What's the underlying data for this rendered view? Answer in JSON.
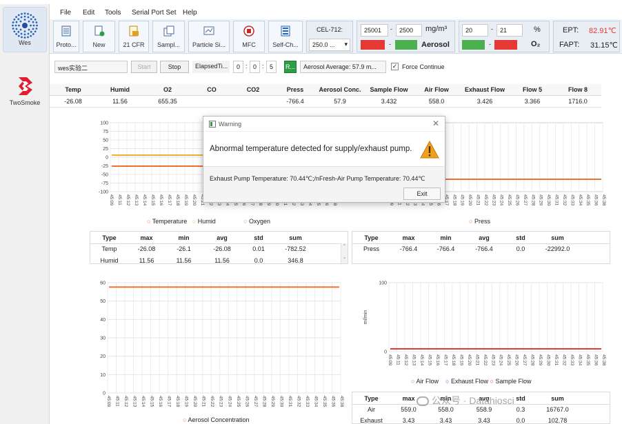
{
  "sidebar": {
    "items": [
      {
        "label": "Wes"
      },
      {
        "label": "TwoSmoke"
      }
    ]
  },
  "menu": {
    "items": [
      "File",
      "Edit",
      "Tools",
      "Serial Port Set",
      "Help"
    ]
  },
  "toolbar": {
    "buttons": [
      {
        "label": "Proto...",
        "icon": "clipboard-icon"
      },
      {
        "label": "New",
        "icon": "new-doc-icon"
      },
      {
        "label": "21 CFR",
        "icon": "cfr-doc-icon"
      },
      {
        "label": "Sampl...",
        "icon": "copy-icon"
      },
      {
        "label": "Particle Si...",
        "icon": "screen-icon"
      },
      {
        "label": "MFC",
        "icon": "record-icon"
      },
      {
        "label": "Self-Ch...",
        "icon": "check-list-icon"
      }
    ],
    "cel": {
      "title": "CEL-712:",
      "select": "250.0 ..."
    },
    "aerosol": {
      "low": "25001",
      "high": "2500",
      "unit": "mg/m³",
      "label": "Aerosol"
    },
    "o2": {
      "low": "20",
      "high": "21",
      "unit": "%",
      "label": "O₂"
    },
    "temps": {
      "ept_label": "EPT:",
      "ept_value": "82.91℃",
      "fapt_label": "FAPT:",
      "fapt_value": "31.15℃"
    }
  },
  "controls": {
    "name": "wes实验二",
    "start": "Start",
    "stop": "Stop",
    "elapsed_label": "ElapsedTi...",
    "h": "0",
    "m": "0",
    "s": "5",
    "r_btn": "R...",
    "avg": "Aerosol Average:  57.9 m...",
    "force": "Force Continue"
  },
  "live": {
    "headers": [
      "Temp",
      "Humid",
      "O2",
      "CO",
      "CO2",
      "Press",
      "Aerosol Conc.",
      "Sample Flow",
      "Air Flow",
      "Exhaust Flow",
      "Flow 5",
      "Flow 8"
    ],
    "values": [
      "-26.08",
      "11.56",
      "655.35",
      "",
      "",
      "-766.4",
      "57.9",
      "3.432",
      "558.0",
      "3.426",
      "3.366",
      "1716.0"
    ]
  },
  "chart1": {
    "yticks": [
      "100",
      "75",
      "50",
      "25",
      "0",
      "-25",
      "-50",
      "-75",
      "-100"
    ],
    "legend": [
      "Temperature",
      "Humid",
      "Oxygen"
    ]
  },
  "chart2": {
    "legend": [
      "Press"
    ]
  },
  "chart3": {
    "yticks": [
      "60",
      "50",
      "40",
      "30",
      "20",
      "10",
      "0"
    ],
    "legend": [
      "Aerosol Concentration"
    ]
  },
  "chart4": {
    "yticks": [
      "100",
      "0"
    ],
    "ylabel": "ml/min",
    "legend": [
      "Air Flow",
      "Exhaust Flow",
      "Sample Flow"
    ]
  },
  "xticks": [
    "45:09",
    "45:11",
    "45:12",
    "45:13",
    "45:14",
    "45:15",
    "45:16",
    "45:17",
    "45:18",
    "45:19",
    "45:20",
    "45:21",
    "45:22",
    "45:23",
    "45:24",
    "45:25",
    "45:26",
    "45:27",
    "45:28",
    "45:29",
    "45:30",
    "45:31",
    "45:32",
    "45:33",
    "45:34",
    "45:35",
    "45:36",
    "45:38"
  ],
  "stats1": {
    "headers": [
      "Type",
      "max",
      "min",
      "avg",
      "std",
      "sum"
    ],
    "rows": [
      [
        "Temp",
        "-26.08",
        "-26.1",
        "-26.08",
        "0.01",
        "-782.52"
      ],
      [
        "Humid",
        "11.56",
        "11.56",
        "11.56",
        "0.0",
        "346.8"
      ]
    ]
  },
  "stats2": {
    "headers": [
      "Type",
      "max",
      "min",
      "avg",
      "std",
      "sum"
    ],
    "rows": [
      [
        "Press",
        "-766.4",
        "-766.4",
        "-766.4",
        "0.0",
        "-22992.0"
      ]
    ]
  },
  "stats4": {
    "headers": [
      "Type",
      "max",
      "min",
      "avg",
      "std",
      "sum"
    ],
    "rows": [
      [
        "Air",
        "559.0",
        "558.0",
        "558.9",
        "0.3",
        "16767.0"
      ],
      [
        "Exhaust",
        "3.43",
        "3.43",
        "3.43",
        "0.0",
        "102.78"
      ]
    ]
  },
  "dialog": {
    "title": "Warning",
    "heading": "Abnormal temperature detected for supply/exhaust pump.",
    "detail": "Exhaust Pump Temperature: 70.44℃;/nFresh-Air Pump Temperature: 70.44℃",
    "exit": "Exit"
  },
  "watermark": "公众号 · Datahiosci",
  "colors": {
    "orange": "#f07030",
    "yellow": "#f0b030",
    "green": "#5cb85c",
    "red": "#e53935",
    "purple": "#c34fc3",
    "navy": "#3f51b5"
  }
}
